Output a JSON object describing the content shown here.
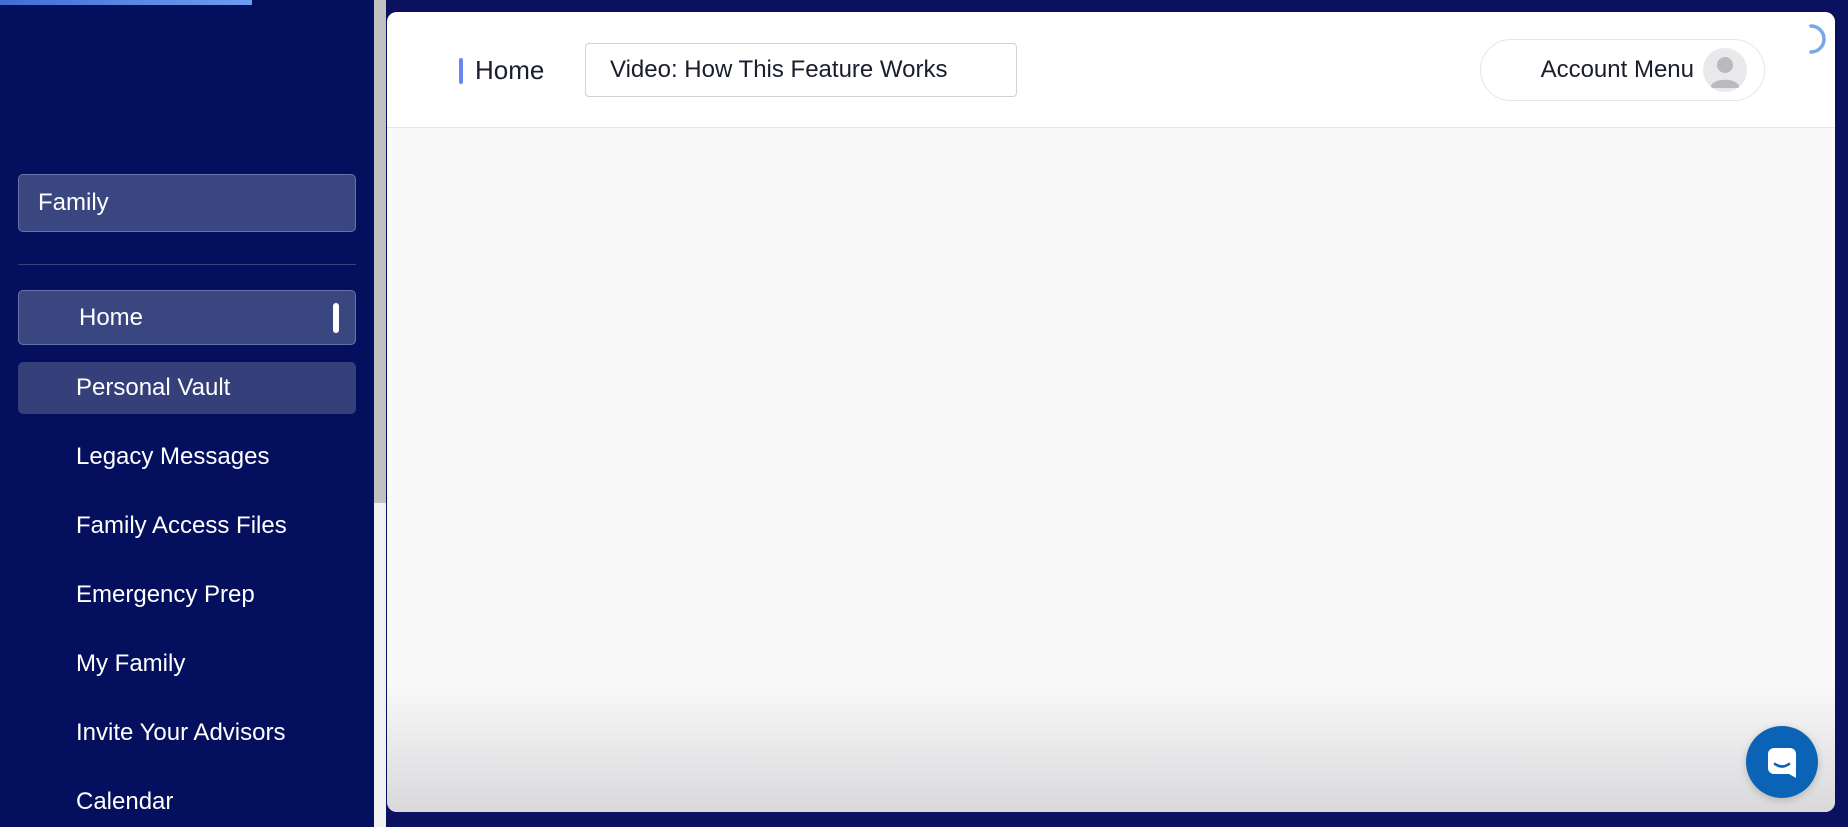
{
  "sidebar": {
    "family_selector": "Family",
    "nav_items": [
      {
        "label": "Home"
      },
      {
        "label": "Personal Vault"
      },
      {
        "label": "Legacy Messages"
      },
      {
        "label": "Family Access Files"
      },
      {
        "label": "Emergency Prep"
      },
      {
        "label": "My Family"
      },
      {
        "label": "Invite Your Advisors"
      },
      {
        "label": "Calendar"
      }
    ]
  },
  "header": {
    "breadcrumb": "Home",
    "video_button": "Video: How This Feature Works",
    "account_menu": "Account Menu"
  },
  "colors": {
    "sidebar_bg": "#04105e",
    "nav_active_bg": "#3a4680",
    "accent": "#6a86f0",
    "chat_launcher": "#0a63b5"
  },
  "icons": {
    "avatar": "user-avatar-icon",
    "spinner": "loading-spinner-icon",
    "chat": "chat-launcher-icon"
  }
}
